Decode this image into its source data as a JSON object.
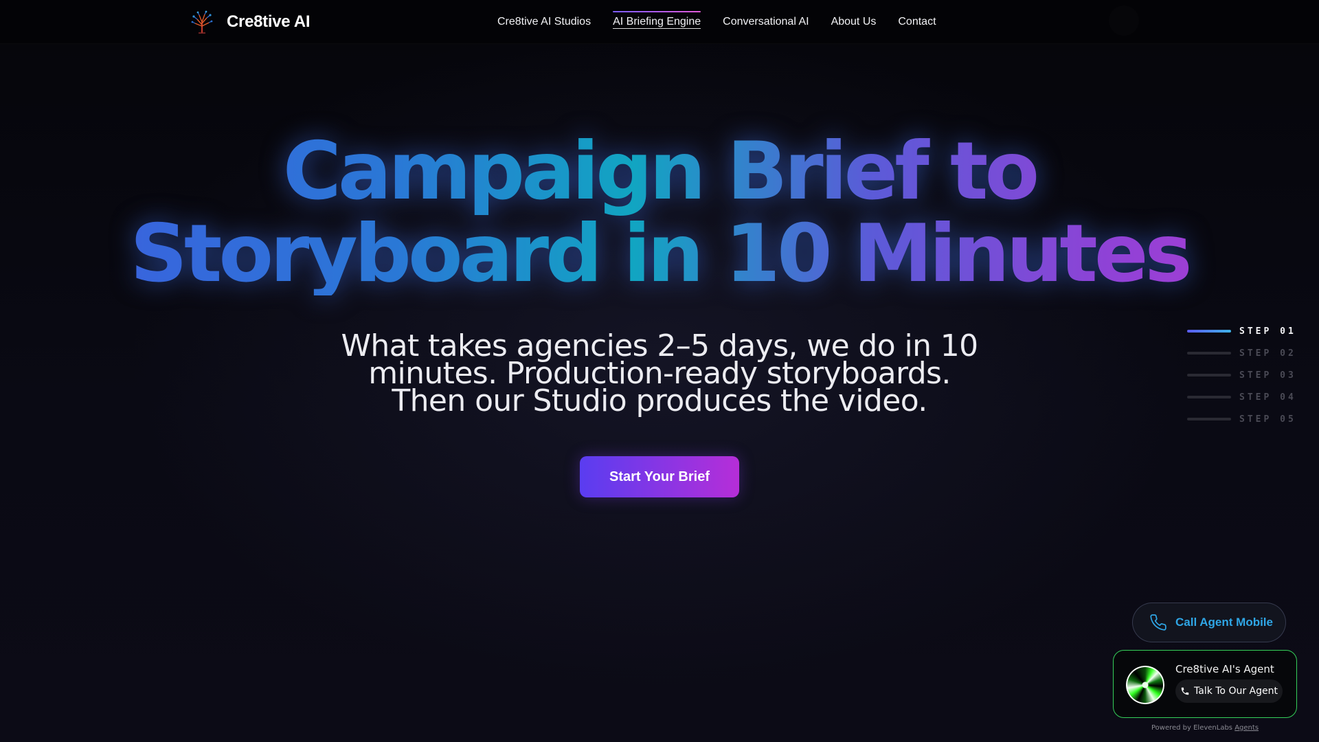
{
  "brand": {
    "name": "Cre8tive AI",
    "logo_icon": "tree-logo-icon"
  },
  "nav": {
    "items": [
      {
        "label": "Cre8tive AI Studios",
        "active": false
      },
      {
        "label": "AI Briefing Engine",
        "active": true
      },
      {
        "label": "Conversational AI",
        "active": false
      },
      {
        "label": "About Us",
        "active": false
      },
      {
        "label": "Contact",
        "active": false
      }
    ]
  },
  "hero": {
    "title_line1": "Campaign Brief to",
    "title_line2": "Storyboard in 10 Minutes",
    "subtitle_line1": "What takes agencies 2–5 days, we do in 10",
    "subtitle_line2": "minutes. Production-ready storyboards.",
    "subtitle_line3": "Then our Studio produces the video.",
    "cta_label": "Start Your Brief"
  },
  "steps": [
    {
      "label": "STEP 01",
      "active": true
    },
    {
      "label": "STEP 02",
      "active": false
    },
    {
      "label": "STEP 03",
      "active": false
    },
    {
      "label": "STEP 04",
      "active": false
    },
    {
      "label": "STEP 05",
      "active": false
    }
  ],
  "call_mobile": {
    "label": "Call Agent Mobile",
    "icon": "phone-icon"
  },
  "agent_widget": {
    "name": "Cre8tive AI's Agent",
    "button_label": "Talk To Our Agent",
    "powered_prefix": "Powered by ElevenLabs",
    "powered_link": "Agents"
  },
  "colors": {
    "accent_purple": "#5a3df0",
    "accent_magenta": "#b62ed8",
    "accent_blue": "#2fa6e6",
    "widget_border": "#35d05a"
  }
}
